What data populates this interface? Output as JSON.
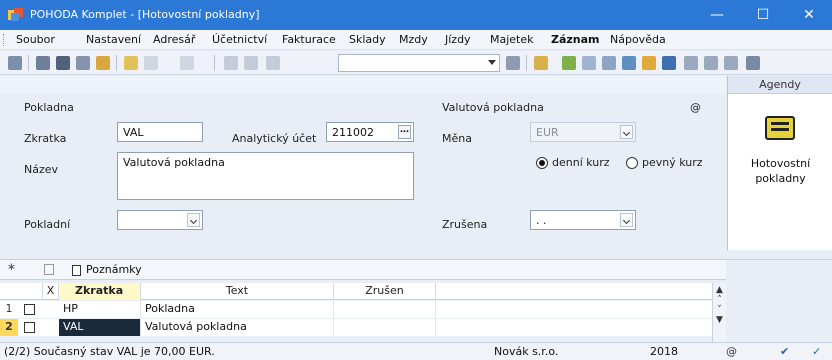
{
  "window": {
    "title": "POHODA Komplet - [Hotovostní pokladny]"
  },
  "menu": [
    "Soubor",
    "Nastavení",
    "Adresář",
    "Účetnictví",
    "Fakturace",
    "Sklady",
    "Mzdy",
    "Jízdy",
    "Majetek",
    "Záznam",
    "Nápověda"
  ],
  "form": {
    "section_left": "Pokladna",
    "section_right": "Valutová pokladna",
    "at_symbol": "@",
    "zkratka": {
      "label": "Zkratka",
      "value": "VAL"
    },
    "ucet": {
      "label": "Analytický účet",
      "value": "211002"
    },
    "nazev": {
      "label": "Název",
      "value": "Valutová pokladna"
    },
    "pokladni": {
      "label": "Pokladní",
      "value": ""
    },
    "mena": {
      "label": "Měna",
      "value": "EUR"
    },
    "kurz_denni": "denní kurz",
    "kurz_pevny": "pevný kurz",
    "zrusena": {
      "label": "Zrušena",
      "value": ". ."
    }
  },
  "agendy": {
    "header": "Agendy",
    "item": "Hotovostní pokladny"
  },
  "grid": {
    "star": "*",
    "tab": "Poznámky",
    "columns": {
      "x": "X",
      "zkratka": "Zkratka",
      "text": "Text",
      "zrusen": "Zrušen"
    },
    "rows": [
      {
        "num": "1",
        "zkratka": "HP",
        "text": "Pokladna",
        "zrusen": ""
      },
      {
        "num": "2",
        "zkratka": "VAL",
        "text": "Valutová pokladna",
        "zrusen": ""
      }
    ]
  },
  "status": {
    "message": "(2/2) Současný stav VAL je 70,00 EUR.",
    "company": "Novák s.r.o.",
    "year": "2018"
  },
  "colors": {
    "titlebar": "#2b78d6",
    "selected_row": "#1b2a3a",
    "sort_header": "#fff8c9"
  }
}
